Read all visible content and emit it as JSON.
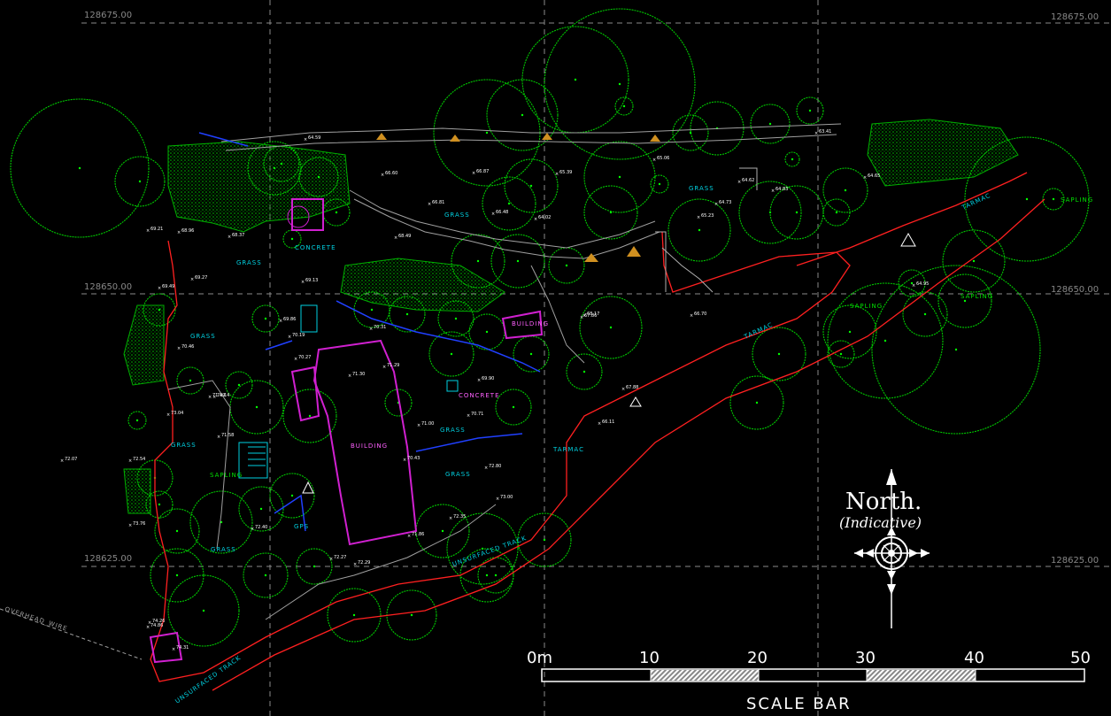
{
  "grid": {
    "northings": [
      {
        "label_left": "128675.00",
        "label_right": "128675.00"
      },
      {
        "label_left": "128650.00",
        "label_right": "128650.00"
      },
      {
        "label_left": "128625.00",
        "label_right": "128625.00"
      }
    ]
  },
  "area_labels": {
    "grass_1": "GRASS",
    "grass_2": "GRASS",
    "grass_3": "GRASS",
    "grass_4": "GRASS",
    "grass_5": "GRASS",
    "grass_6": "GRASS",
    "grass_7": "GRASS",
    "grass_8": "GRASS",
    "tarmac_1": "TARMAC",
    "tarmac_2": "TARMAC",
    "tarmac_3": "TARMAC",
    "concrete_1": "CONCRETE",
    "concrete_2": "CONCRETE",
    "building_1": "BUILDING",
    "building_2": "BUILDING",
    "unsurfaced_1": "UNSURFACED TRACK",
    "unsurfaced_2": "UNSURFACED TRACK",
    "overhead_wire": "OVERHEAD_WIRE",
    "gps": "GPS",
    "sapling_1": "SAPLING",
    "sapling_2": "SAPLING",
    "sapling_3": "SAPLING",
    "sapling_4": "SAPLING"
  },
  "spot_levels": [
    "64.59",
    "66.60",
    "69.21",
    "68.96",
    "68.37",
    "69.27",
    "69.49",
    "70.46",
    "71.49",
    "72.07",
    "73.04",
    "72.54",
    "73.76",
    "74.86",
    "74.26",
    "74.31",
    "66.81",
    "66.48",
    "66.87",
    "64.02",
    "65.39",
    "65.06",
    "64.73",
    "64.62",
    "65.23",
    "64.83",
    "63.41",
    "64.95",
    "66.70",
    "67.86",
    "70.31",
    "71.29",
    "71.30",
    "69.90",
    "70.71",
    "71.00",
    "72.80",
    "73.00",
    "72.35",
    "71.86",
    "72.27",
    "72.29",
    "72.40",
    "71.14",
    "71.58",
    "70.27",
    "70.19",
    "69.13",
    "68.49",
    "64.65",
    "66.11",
    "67.88",
    "68.17",
    "69.86",
    "70.43"
  ],
  "compass": {
    "title": "North.",
    "subtitle": "(Indicative)"
  },
  "scale_bar": {
    "ticks": [
      "0m",
      "10",
      "20",
      "30",
      "40",
      "50"
    ],
    "title": "SCALE BAR"
  },
  "colors": {
    "background": "#000000",
    "tree": "#00c800",
    "boundary": "#ff2020",
    "building": "#d020d0",
    "path": "#b0b0b0",
    "grid": "#9a9a9a",
    "annotation": "#00d0e0"
  }
}
